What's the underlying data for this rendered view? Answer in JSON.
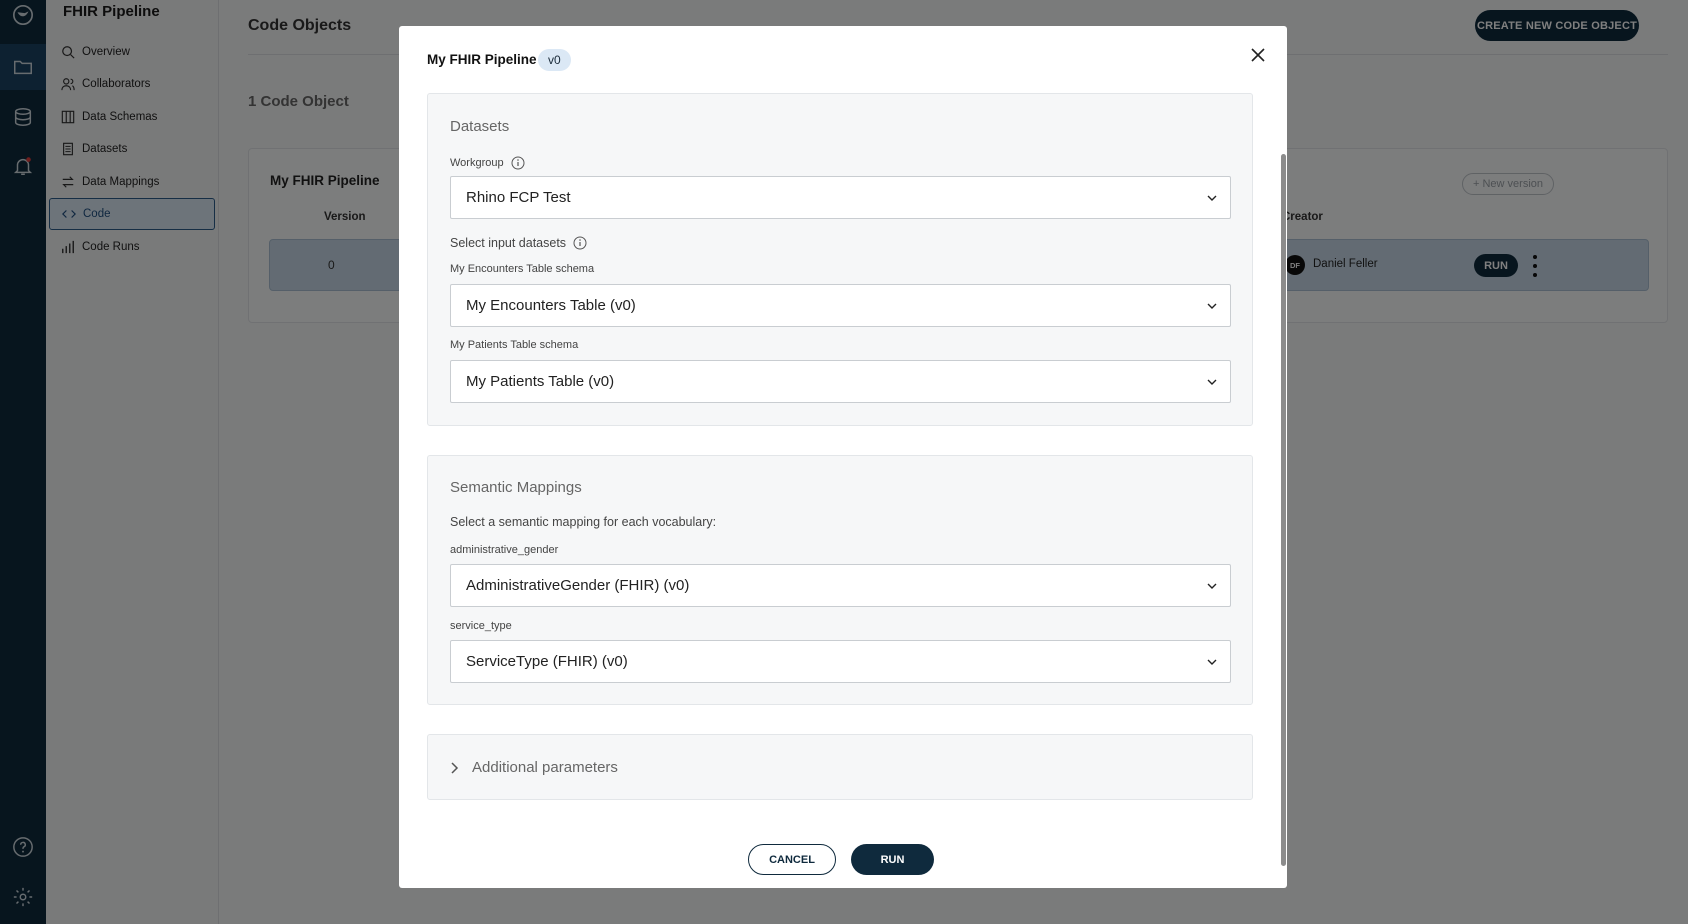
{
  "rail": {
    "icons": [
      "logo-icon",
      "folder-icon",
      "database-icon",
      "bell-icon",
      "help-icon",
      "gear-icon"
    ],
    "accent": "#0f2a3d"
  },
  "sidebar": {
    "project_title": "FHIR Pipeline",
    "items": [
      {
        "label": "Overview",
        "icon": "search-icon"
      },
      {
        "label": "Collaborators",
        "icon": "users-icon"
      },
      {
        "label": "Data Schemas",
        "icon": "columns-icon"
      },
      {
        "label": "Datasets",
        "icon": "dataset-icon"
      },
      {
        "label": "Data Mappings",
        "icon": "arrows-icon"
      },
      {
        "label": "Code",
        "icon": "code-icon",
        "active": true
      },
      {
        "label": "Code Runs",
        "icon": "bar-chart-icon"
      }
    ]
  },
  "main": {
    "page_title": "Code Objects",
    "create_button": "CREATE NEW CODE OBJECT",
    "count_label": "1 Code Object",
    "card": {
      "title": "My FHIR Pipeline",
      "new_version": "+ New version",
      "columns": {
        "version": "Version",
        "creator": "Creator"
      },
      "row": {
        "version": "0",
        "creator_initials": "DF",
        "creator": "Daniel Feller",
        "run": "RUN"
      }
    }
  },
  "modal": {
    "title": "My FHIR Pipeline",
    "version_badge": "v0",
    "datasets": {
      "heading": "Datasets",
      "workgroup_label": "Workgroup",
      "workgroup_value": "Rhino FCP Test",
      "select_input_label": "Select input datasets",
      "encounters_label": "My Encounters Table schema",
      "encounters_value": "My Encounters Table (v0)",
      "patients_label": "My Patients Table schema",
      "patients_value": "My Patients Table (v0)"
    },
    "semantic": {
      "heading": "Semantic Mappings",
      "instruction": "Select a semantic mapping for each vocabulary:",
      "gender_label": "administrative_gender",
      "gender_value": "AdministrativeGender (FHIR) (v0)",
      "service_label": "service_type",
      "service_value": "ServiceType (FHIR) (v0)"
    },
    "additional_parameters": "Additional parameters",
    "cancel": "CANCEL",
    "run": "RUN"
  }
}
